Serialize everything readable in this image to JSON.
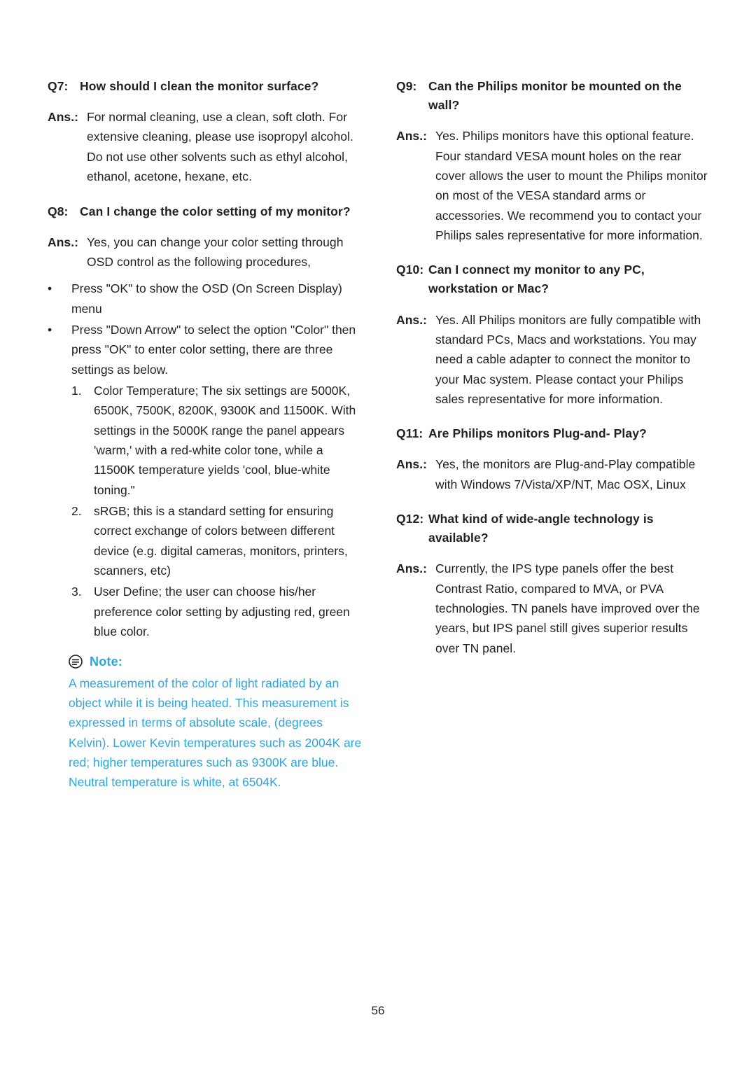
{
  "page": {
    "number": "56"
  },
  "left_column": {
    "q7": {
      "label": "Q7:",
      "question": "How should I clean the monitor surface?",
      "ans_label": "Ans.:",
      "answer": "For normal cleaning, use a clean, soft cloth. For extensive cleaning, please use isopropyl alcohol. Do not use other solvents such as ethyl alcohol, ethanol, acetone, hexane, etc."
    },
    "q8": {
      "label": "Q8:",
      "question": "Can I change the color setting of my monitor?",
      "ans_label": "Ans.:",
      "answer": "Yes, you can change your color setting through OSD control as the following procedures,",
      "bullets": [
        {
          "mark": "•",
          "text": "Press \"OK\" to show the OSD (On Screen Display) menu"
        },
        {
          "mark": "•",
          "text": "Press \"Down Arrow\" to select the option \"Color\" then press \"OK\" to enter color setting, there are three settings as below."
        }
      ],
      "numbered": [
        {
          "mark": "1.",
          "text": "Color Temperature; The six settings are 5000K, 6500K, 7500K, 8200K, 9300K and 11500K. With settings in the 5000K range the panel appears 'warm,' with a red-white color tone, while a 11500K temperature yields 'cool, blue-white toning.\""
        },
        {
          "mark": "2.",
          "text": "sRGB; this is a standard setting for ensuring correct exchange of colors between different device (e.g. digital cameras, monitors, printers, scanners, etc)"
        },
        {
          "mark": "3.",
          "text": "User Define; the user can choose his/her preference color setting by adjusting red, green blue color."
        }
      ]
    },
    "note": {
      "icon": "note-icon",
      "title": "Note:",
      "body": "A measurement of the color of light radiated by an object while it is being heated. This measurement is expressed in terms of absolute scale, (degrees Kelvin). Lower Kevin temperatures such as 2004K are red; higher temperatures such as 9300K are blue. Neutral temperature is white, at 6504K.",
      "color": "#2ba6de"
    }
  },
  "right_column": {
    "q9": {
      "label": "Q9:",
      "question": "Can the Philips monitor be mounted on the wall?",
      "ans_label": "Ans.:",
      "answer": "Yes. Philips monitors have this optional feature. Four standard VESA mount holes on the rear cover allows the user to mount the Philips monitor on most of the VESA standard arms or accessories. We recommend you to contact your Philips sales representative for more information."
    },
    "q10": {
      "label": "Q10:",
      "question": "Can I connect my monitor to any PC, workstation or Mac?",
      "ans_label": "Ans.:",
      "answer": "Yes. All Philips monitors are fully compatible with standard PCs, Macs and workstations. You may need a cable adapter to connect the monitor to your Mac system. Please contact your Philips sales representative for more information."
    },
    "q11": {
      "label": "Q11:",
      "question": "Are Philips monitors Plug-and- Play?",
      "ans_label": "Ans.:",
      "answer": "Yes, the monitors are Plug-and-Play compatible with Windows 7/Vista/XP/NT, Mac OSX, Linux"
    },
    "q12": {
      "label": "Q12:",
      "question": "What kind of wide-angle technology is available?",
      "ans_label": "Ans.:",
      "answer": "Currently, the IPS type panels offer the best Contrast Ratio, compared to MVA, or PVA technologies. TN panels have improved over the years, but IPS panel still gives superior results over TN panel."
    }
  }
}
